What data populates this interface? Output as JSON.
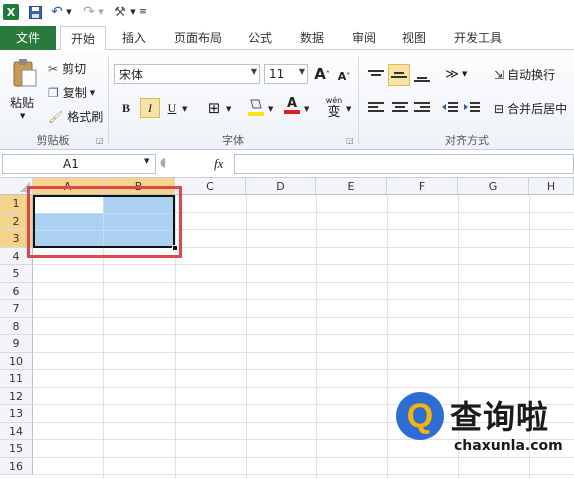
{
  "colors": {
    "file_tab": "#2a7a3b",
    "selection": "#acd0ef",
    "header_selected": "#f5d38a",
    "annotation_box": "#e0474c",
    "watermark_blue": "#2b6fd6"
  },
  "qat": {
    "icons": [
      "excel-app-icon",
      "save-icon",
      "undo-icon",
      "redo-icon",
      "format-painter-icon",
      "customize-icon"
    ]
  },
  "tabs": [
    "文件",
    "开始",
    "插入",
    "页面布局",
    "公式",
    "数据",
    "审阅",
    "视图",
    "开发工具"
  ],
  "ribbon": {
    "clipboard": {
      "paste": "粘贴",
      "cut": "剪切",
      "copy": "复制",
      "format_painter": "格式刷",
      "group_label": "剪贴板"
    },
    "font": {
      "font_name": "宋体",
      "font_size": "11",
      "bold": "B",
      "italic": "I",
      "underline": "U",
      "font_color_glyph": "A",
      "grow_glyph": "A",
      "shrink_glyph": "A",
      "wen_glyph": "wén",
      "wen_char": "变",
      "group_label": "字体"
    },
    "alignment": {
      "wrap_text": "自动换行",
      "merge_center": "合并后居中",
      "group_label": "对齐方式"
    }
  },
  "formula_bar": {
    "name_box": "A1",
    "fx": "fx",
    "value": ""
  },
  "grid": {
    "columns": [
      "A",
      "B",
      "C",
      "D",
      "E",
      "F",
      "G",
      "H"
    ],
    "rows": [
      "1",
      "2",
      "3",
      "4",
      "5",
      "6",
      "7",
      "8",
      "9",
      "10",
      "11",
      "12",
      "13",
      "14",
      "15",
      "16"
    ],
    "selected_range": "A1:B3"
  },
  "watermark": {
    "logo_char": "Q",
    "name": "查询啦",
    "domain": "chaxunla.com"
  }
}
